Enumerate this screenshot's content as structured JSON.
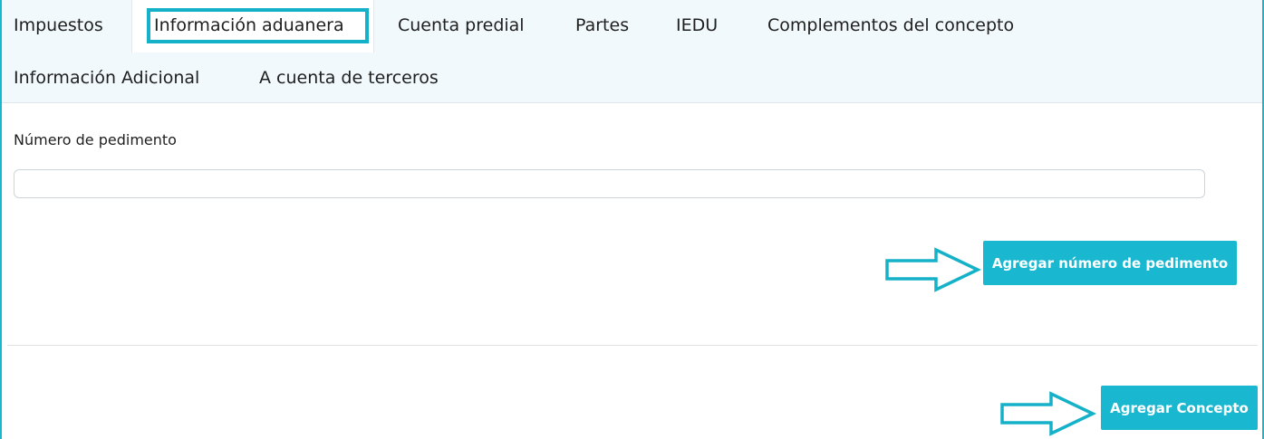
{
  "tabs": {
    "row1": [
      "Impuestos",
      "Información aduanera",
      "Cuenta predial",
      "Partes",
      "IEDU",
      "Complementos del concepto"
    ],
    "row2": [
      "Información Adicional",
      "A cuenta de terceros"
    ],
    "active": "Información aduanera"
  },
  "form": {
    "pedimento_label": "Número de pedimento",
    "pedimento_value": "",
    "add_pedimento_button": "Agregar número de pedimento"
  },
  "footer": {
    "add_concept_button": "Agregar Concepto"
  },
  "colors": {
    "accent": "#1ab8d0",
    "tab_background": "#f1f9fc",
    "highlight": "#14b1c9"
  }
}
